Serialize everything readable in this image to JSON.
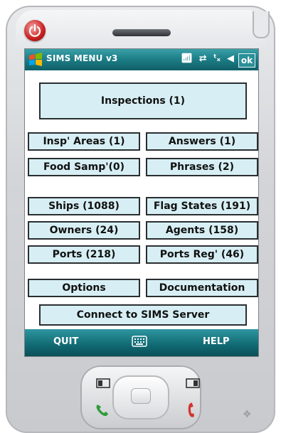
{
  "window": {
    "title": "SIMS MENU v3",
    "ok_label": "ok",
    "status_icons": [
      "antenna-icon",
      "sync-icon",
      "signal-off-icon",
      "speaker-icon"
    ]
  },
  "buttons": {
    "inspections": "Inspections (1)",
    "insp_areas": "Insp' Areas (1)",
    "answers": "Answers (1)",
    "food_samp": "Food Samp'(0)",
    "phrases": "Phrases (2)",
    "ships": "Ships (1088)",
    "flag_states": "Flag States (191)",
    "owners": "Owners (24)",
    "agents": "Agents (158)",
    "ports": "Ports (218)",
    "ports_reg": "Ports Reg' (46)",
    "options": "Options",
    "documentation": "Documentation",
    "connect": "Connect to SIMS Server"
  },
  "menubar": {
    "left": "QUIT",
    "right": "HELP"
  },
  "colors": {
    "titlebar": "#1e7f88",
    "button_fill": "#d7eff4",
    "button_border": "#2a2e31",
    "power": "#c81e1e",
    "call_green": "#2e9b3a",
    "end_red": "#d0342c"
  }
}
